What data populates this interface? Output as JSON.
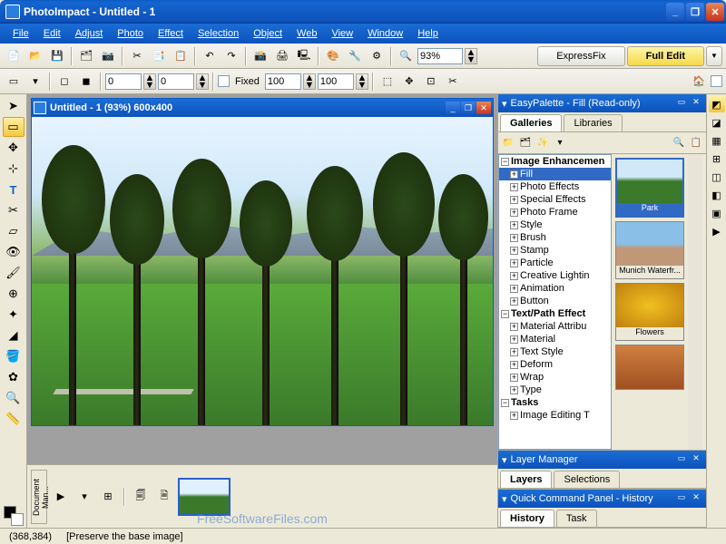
{
  "app": {
    "title": "PhotoImpact - Untitled - 1"
  },
  "menu": [
    "File",
    "Edit",
    "Adjust",
    "Photo",
    "Effect",
    "Selection",
    "Object",
    "Web",
    "View",
    "Window",
    "Help"
  ],
  "toolbar1": {
    "zoom_value": "93%",
    "mode_express": "ExpressFix",
    "mode_full": "Full Edit"
  },
  "toolbar2": {
    "x_value": "0",
    "y_value": "0",
    "fixed_label": "Fixed",
    "w_value": "100",
    "h_value": "100"
  },
  "document": {
    "title": "Untitled - 1 (93%) 600x400"
  },
  "thumb_tab": "Document Man...",
  "easypalette": {
    "title": "EasyPalette - Fill (Read-only)",
    "tabs": [
      "Galleries",
      "Libraries"
    ],
    "tree": {
      "root": "Image Enhancemen",
      "items": [
        "Fill",
        "Photo Effects",
        "Special Effects",
        "Photo Frame",
        "Style",
        "Brush",
        "Stamp",
        "Particle",
        "Creative Lightin",
        "Animation",
        "Button"
      ],
      "root2": "Text/Path Effect",
      "items2": [
        "Material Attribu",
        "Material",
        "Text Style",
        "Deform",
        "Wrap",
        "Type"
      ],
      "root3": "Tasks",
      "items3": [
        "Image Editing T"
      ]
    },
    "gallery": [
      "Park",
      "Munich Waterfr...",
      "Flowers"
    ]
  },
  "layer_panel": {
    "title": "Layer Manager",
    "tabs": [
      "Layers",
      "Selections"
    ]
  },
  "quick_panel": {
    "title": "Quick Command Panel - History",
    "tabs": [
      "History",
      "Task"
    ]
  },
  "status": {
    "coords": "(368,384)",
    "hint": "[Preserve the base image]"
  },
  "watermark": "FreeSoftwareFiles.com"
}
